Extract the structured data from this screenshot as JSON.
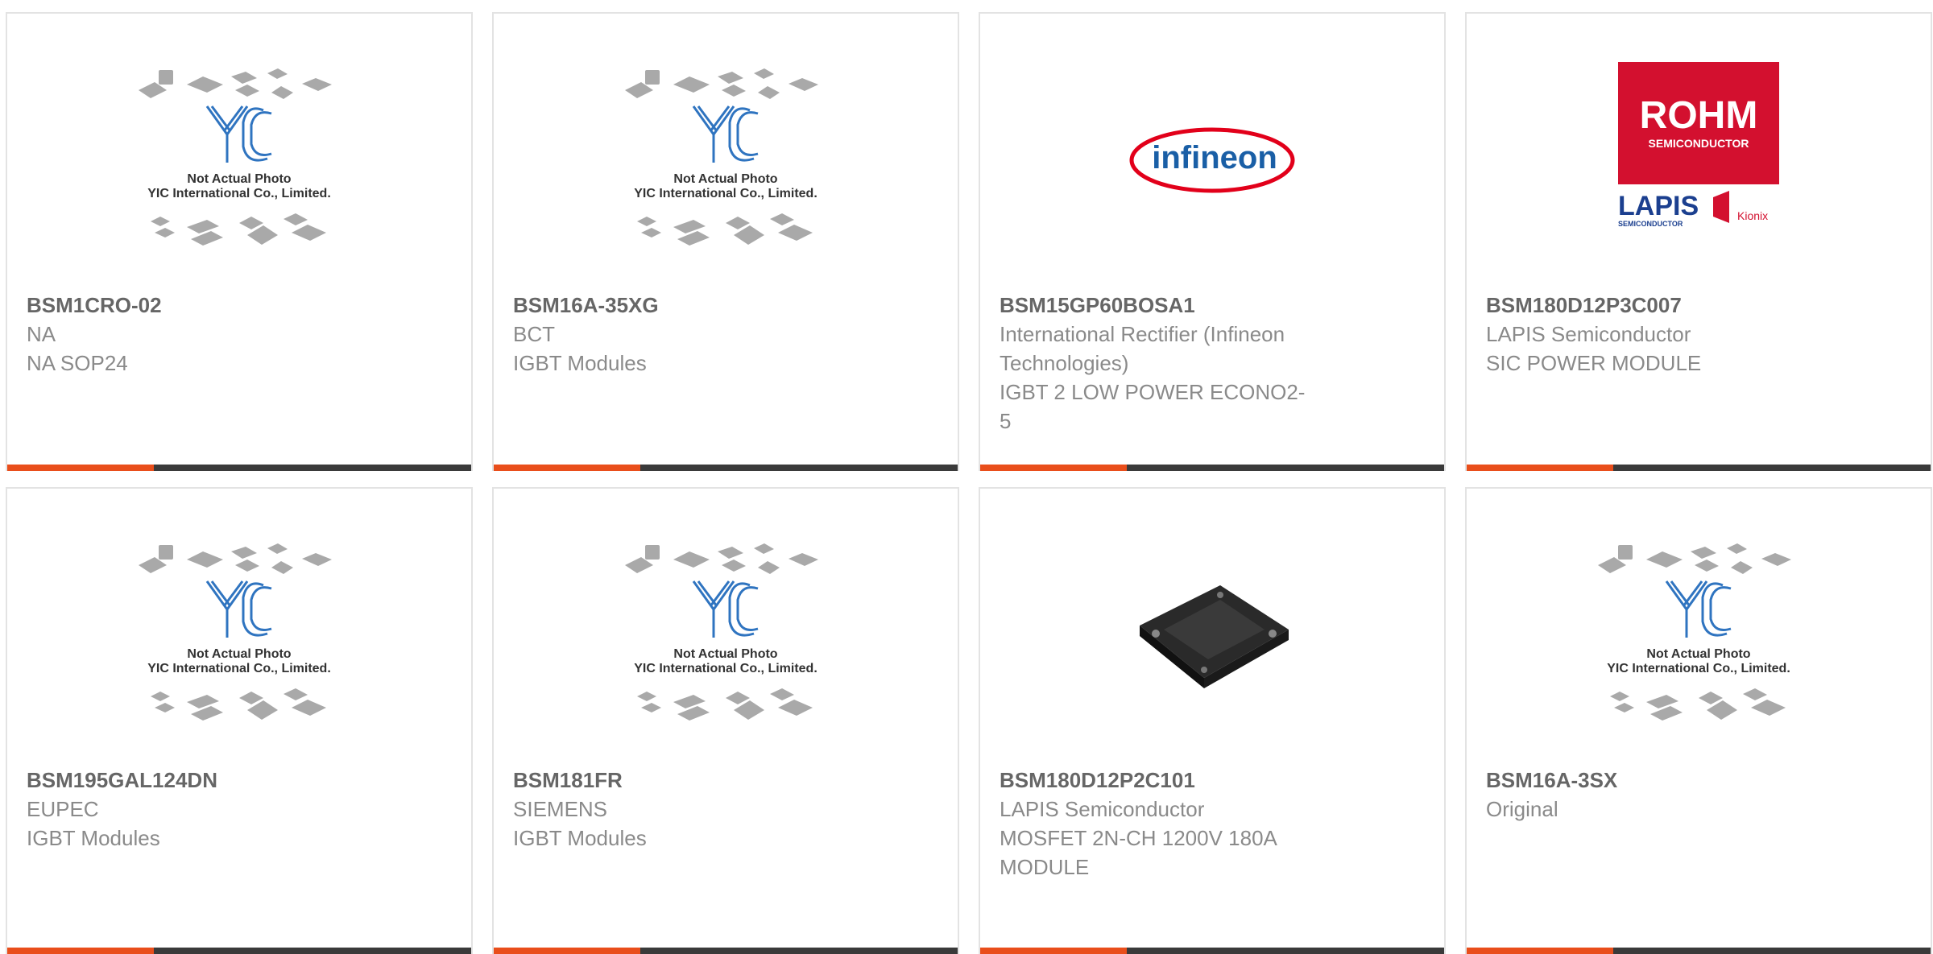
{
  "theme": {
    "accent": "#e94e1b",
    "bar": "#3a3a3a",
    "title_color": "#666666",
    "text_color": "#8a8a8a"
  },
  "placeholder": {
    "logo_text": "YIC",
    "line1": "Not Actual Photo",
    "line2": "YIC International Co., Limited."
  },
  "brand_logos": {
    "infineon": "infineon",
    "rohm": "ROHM",
    "rohm_sub": "SEMICONDUCTOR",
    "lapis": "LAPIS",
    "lapis_sub": "SEMICONDUCTOR",
    "kionix": "Kionix"
  },
  "products": [
    {
      "part": "BSM1CRO-02",
      "lines": [
        "NA",
        "NA SOP24"
      ],
      "image": "placeholder"
    },
    {
      "part": "BSM16A-35XG",
      "lines": [
        "BCT",
        "IGBT Modules"
      ],
      "image": "placeholder"
    },
    {
      "part": "BSM15GP60BOSA1",
      "lines": [
        "International Rectifier (Infineon",
        "Technologies)",
        "IGBT 2 LOW POWER ECONO2-",
        "5"
      ],
      "image": "infineon-logo"
    },
    {
      "part": "BSM180D12P3C007",
      "lines": [
        "LAPIS Semiconductor",
        "SIC POWER MODULE"
      ],
      "image": "rohm-lapis-logo"
    },
    {
      "part": "BSM195GAL124DN",
      "lines": [
        "EUPEC",
        "IGBT Modules"
      ],
      "image": "placeholder"
    },
    {
      "part": "BSM181FR",
      "lines": [
        "SIEMENS",
        "IGBT Modules"
      ],
      "image": "placeholder"
    },
    {
      "part": "BSM180D12P2C101",
      "lines": [
        "LAPIS Semiconductor",
        "MOSFET 2N-CH 1200V 180A",
        "MODULE"
      ],
      "image": "power-module-photo"
    },
    {
      "part": "BSM16A-3SX",
      "lines": [
        "Original"
      ],
      "image": "placeholder"
    }
  ]
}
